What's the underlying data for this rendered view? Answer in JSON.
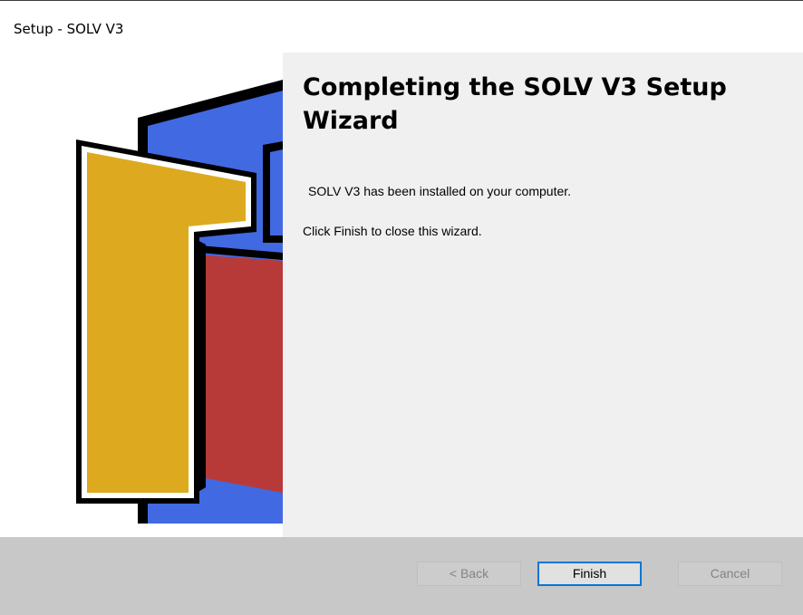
{
  "window": {
    "title": "Setup - SOLV V3"
  },
  "content": {
    "heading": "Completing the SOLV V3 Setup Wizard",
    "installed_text": "SOLV V3 has been installed on your computer.",
    "finish_instruction": "Click Finish to close this wizard."
  },
  "buttons": {
    "back_label": "< Back",
    "finish_label": "Finish",
    "cancel_label": "Cancel"
  },
  "logo": {
    "icon": "solv-logo-graphic",
    "colors": {
      "blue": "#4169e1",
      "yellow": "#dda91f",
      "red": "#b83a38",
      "outline": "#000000"
    }
  },
  "colors": {
    "content_background": "#f0f0f0",
    "footer_background": "#c8c8c8",
    "default_button_border": "#0078d7"
  }
}
